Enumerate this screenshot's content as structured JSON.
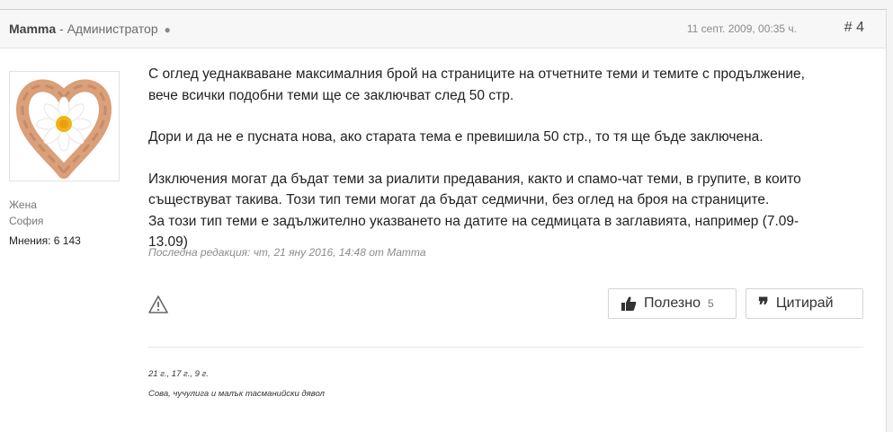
{
  "post": {
    "author_name": "Mamma",
    "author_separator": " - ",
    "author_role": "Администратор",
    "status_dot": "●",
    "date": "11 септ. 2009, 00:35 ч.",
    "post_number": "# 4",
    "profile": {
      "gender": "Жена",
      "city": "София",
      "posts_count": "Мнения: 6 143"
    },
    "body": {
      "p1": "С оглед уеднакваване максималния брой на страниците на отчетните теми и темите с продължение, вече всички подобни теми ще се заключват след 50 стр.",
      "p2": "Дори и да не е пусната нова, ако старата тема е превишила 50 стр., то тя ще бъде заключена.",
      "p3a": "Изключения могат да бъдат теми за риалити предавания, както и спамо-чат теми, в групите, в които съществуват такива. Този тип теми могат да бъдат седмични, без оглед на броя на страниците.",
      "p3b": "За този тип теми е задължително указването на датите на седмицата в заглавията, например (7.09-13.09)"
    },
    "edited_note": "Последна редакция: чт, 21 яну 2016, 14:48 от Mamma",
    "actions": {
      "like_label": "Полезно",
      "like_count": "5",
      "quote_label": "Цитирай"
    },
    "signature": {
      "line1": "21 г., 17 г., 9 г.",
      "line2": "Сова, чучулига и малък тасманийски дявол"
    },
    "icons": {
      "warning": "warning-icon",
      "thumb": "thumbs-up-icon",
      "quote": "quote-icon",
      "avatar": "heart-hands-daisy-avatar"
    }
  }
}
